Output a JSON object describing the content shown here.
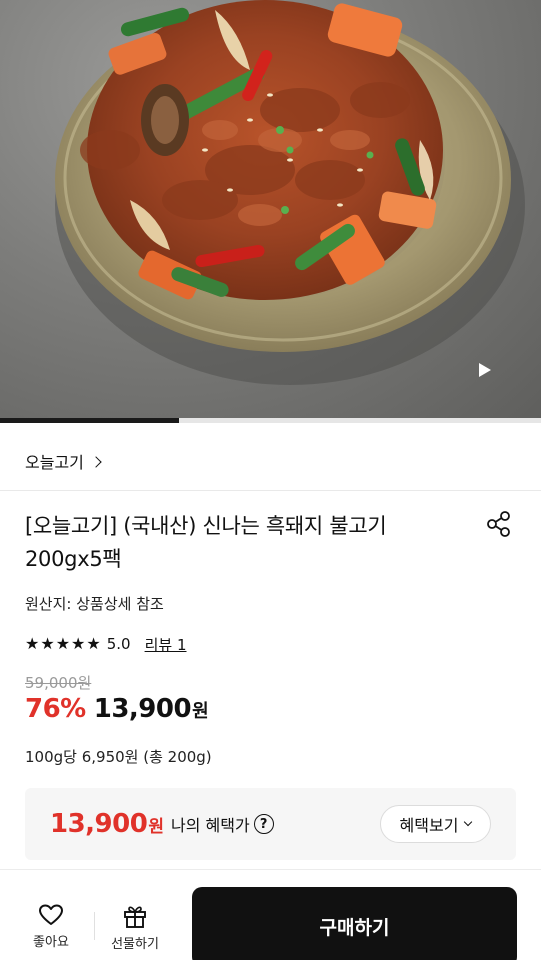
{
  "hero": {
    "image_alt": "pork bulgogi in ceramic bowl",
    "video_progress_fraction": 0.33
  },
  "brand": {
    "name": "오늘고기"
  },
  "product": {
    "title": "[오늘고기] (국내산) 신나는 흑돼지 불고기 200gx5팩",
    "origin": "원산지: 상품상세 참조",
    "rating": {
      "stars": 5,
      "score": "5.0",
      "review_link": "리뷰 1"
    },
    "original_price": "59,000원",
    "discount": "76%",
    "sale_price": "13,900",
    "currency": "원",
    "unit_price": "100g당 6,950원 (총 200g)"
  },
  "benefit": {
    "amount": "13,900",
    "currency": "원",
    "label": "나의 혜택가",
    "help_symbol": "?",
    "button_label": "혜택보기"
  },
  "bottom_bar": {
    "like_label": "좋아요",
    "gift_label": "선물하기",
    "buy_label": "구매하기"
  },
  "colors": {
    "accent_red": "#e0322a",
    "buy_button_bg": "#111111"
  },
  "icons": [
    "play-icon",
    "chevron-right-icon",
    "share-icon",
    "star-icon",
    "help-icon",
    "chevron-down-icon",
    "heart-icon",
    "gift-icon"
  ]
}
